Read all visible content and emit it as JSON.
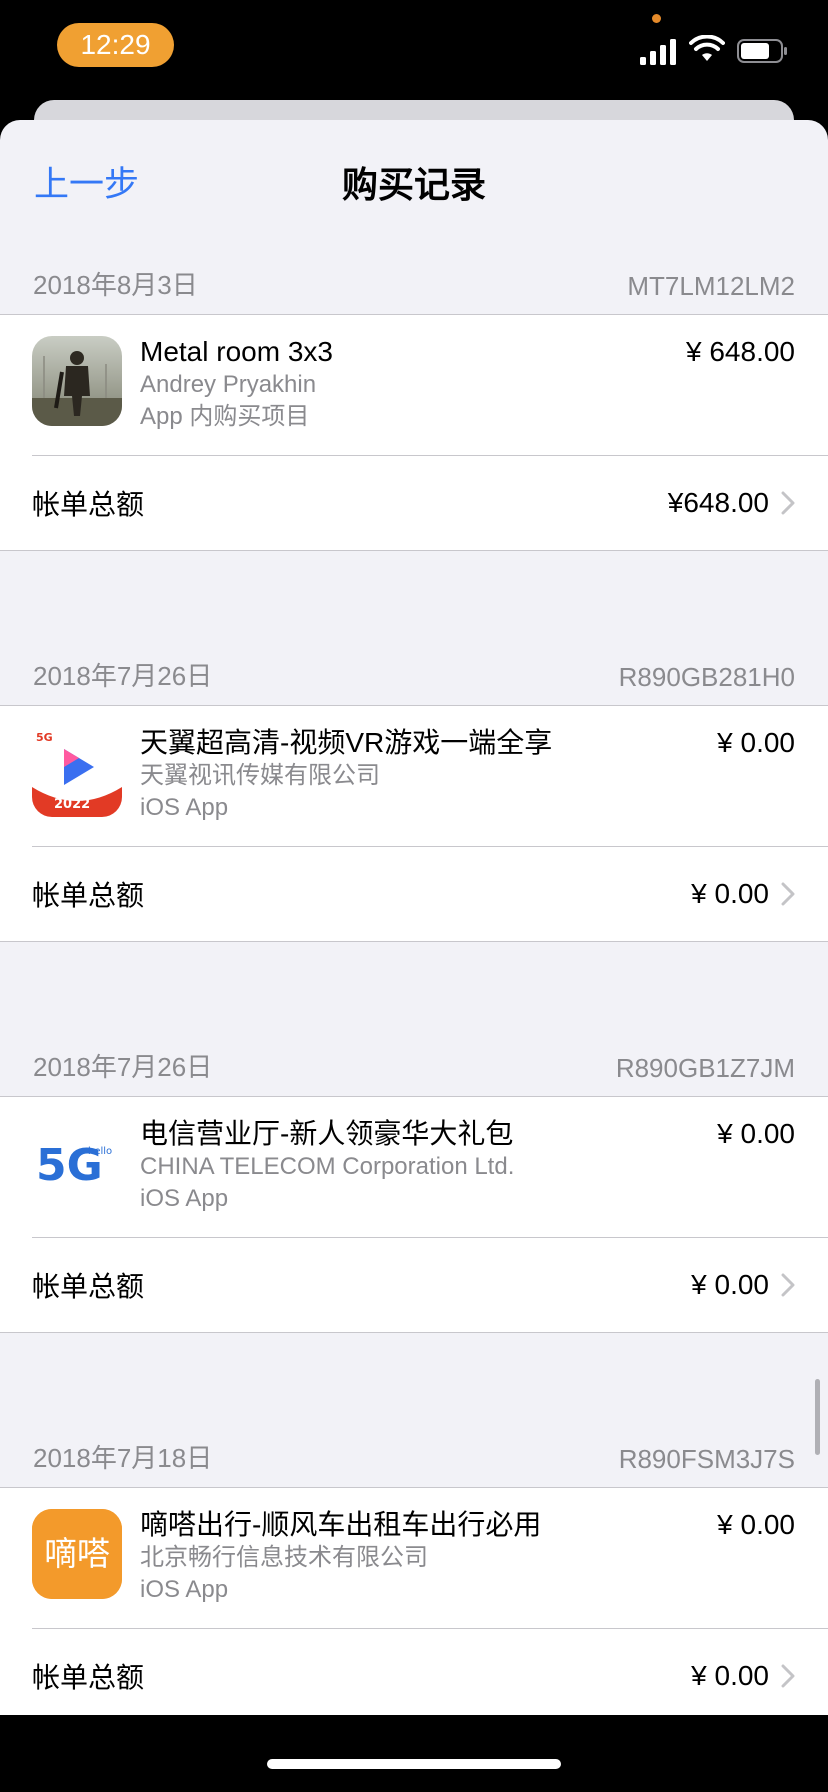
{
  "status_bar": {
    "time": "12:29",
    "accent_color": "#f0a032"
  },
  "nav": {
    "back_label": "上一步",
    "title": "购买记录"
  },
  "accent_color": "#3478f6",
  "purchases": [
    {
      "date": "2018年8月3日",
      "order_id": "MT7LM12LM2",
      "item_name": "Metal room 3x3",
      "developer": "Andrey Pryakhin",
      "item_type": "App 内购买项目",
      "price": "¥ 648.00",
      "total_label": "帐单总额",
      "total": "¥648.00",
      "icon": "soldier-game-icon"
    },
    {
      "date": "2018年7月26日",
      "order_id": "R890GB281H0",
      "item_name": "天翼超高清-视频VR游戏一端全享",
      "developer": "天翼视讯传媒有限公司",
      "item_type": "iOS App",
      "price": "¥ 0.00",
      "total_label": "帐单总额",
      "total": "¥ 0.00",
      "icon": "tianyi-video-icon",
      "icon_badge": "5G",
      "icon_year": "2022"
    },
    {
      "date": "2018年7月26日",
      "order_id": "R890GB1Z7JM",
      "item_name": "电信营业厅-新人领豪华大礼包",
      "developer": "CHINA TELECOM Corporation Ltd.",
      "item_type": "iOS App",
      "price": "¥ 0.00",
      "total_label": "帐单总额",
      "total": "¥ 0.00",
      "icon": "telecom-5g-icon",
      "icon_text": "5G",
      "icon_small": "hello"
    },
    {
      "date": "2018年7月18日",
      "order_id": "R890FSM3J7S",
      "item_name": "嘀嗒出行-顺风车出租车出行必用",
      "developer": "北京畅行信息技术有限公司",
      "item_type": "iOS App",
      "price": "¥ 0.00",
      "total_label": "帐单总额",
      "total": "¥ 0.00",
      "icon": "dida-icon",
      "icon_text": "嘀嗒"
    }
  ]
}
